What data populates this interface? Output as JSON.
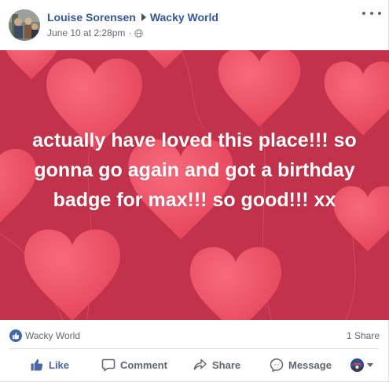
{
  "post": {
    "author": "Louise Sorensen",
    "target_page": "Wacky World",
    "timestamp": "June 10 at 2:28pm",
    "separator": "·",
    "privacy_icon": "globe-icon",
    "more_icon": "more-options-icon"
  },
  "status": {
    "text": "actually have loved this place!!! so gonna go again and got a birthday badge for max!!! so good!!! xx",
    "background": "red-hearts-balloons",
    "colors": {
      "background": "#c2324b",
      "heart": "#f0566b",
      "text": "#ffffff"
    }
  },
  "stats": {
    "page_tag": "Wacky World",
    "shares": "1 Share"
  },
  "actions": {
    "like": "Like",
    "comment": "Comment",
    "share": "Share",
    "message": "Message"
  },
  "colors": {
    "link": "#365899",
    "like_blue": "#4b67a1",
    "muted": "#616770"
  }
}
